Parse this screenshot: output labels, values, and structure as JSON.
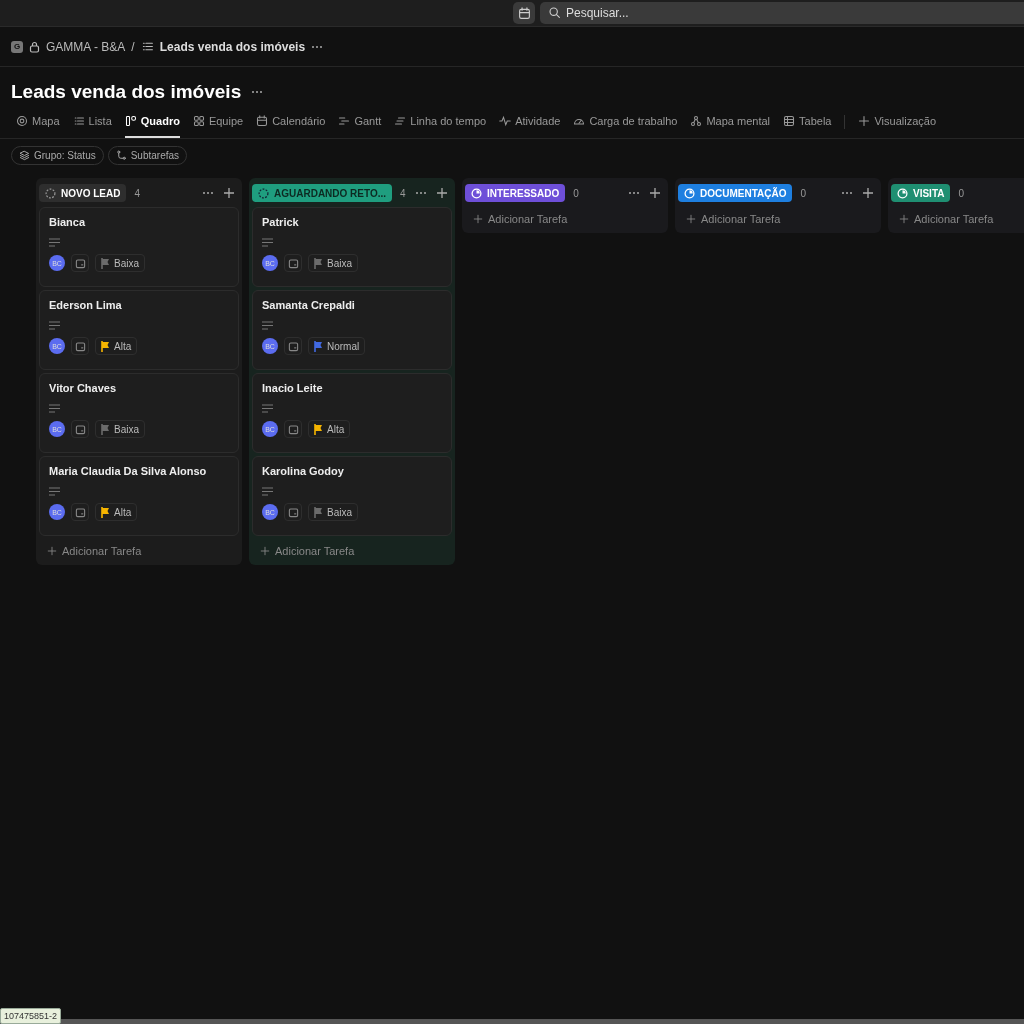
{
  "topbar": {
    "search": {
      "placeholder": "Pesquisar..."
    }
  },
  "breadcrumb": {
    "workspace_badge": "G",
    "workspace": "GAMMA - B&A",
    "separator": "/",
    "list": "Leads venda dos imóveis"
  },
  "title": "Leads venda dos imóveis",
  "tabs": [
    {
      "label": "Mapa",
      "selected": false
    },
    {
      "label": "Lista",
      "selected": false
    },
    {
      "label": "Quadro",
      "selected": true
    },
    {
      "label": "Equipe",
      "selected": false
    },
    {
      "label": "Calendário",
      "selected": false
    },
    {
      "label": "Gantt",
      "selected": false
    },
    {
      "label": "Linha do tempo",
      "selected": false
    },
    {
      "label": "Atividade",
      "selected": false
    },
    {
      "label": "Carga de trabalho",
      "selected": false
    },
    {
      "label": "Mapa mental",
      "selected": false
    },
    {
      "label": "Tabela",
      "selected": false
    }
  ],
  "add_view": "Visualização",
  "filters": [
    {
      "label": "Grupo: Status"
    },
    {
      "label": "Subtarefas"
    }
  ],
  "columns": [
    {
      "status": "NOVO LEAD",
      "kind": "dashed",
      "color": "#2e2e2e",
      "count": "4",
      "tasks": [
        {
          "name": "Bianca",
          "assignee": "BC",
          "priority": "Baixa",
          "color": "#6b6b6b"
        },
        {
          "name": "Ederson Lima",
          "assignee": "BC",
          "priority": "Alta",
          "color": "#f5b400"
        },
        {
          "name": "Vitor Chaves",
          "assignee": "BC",
          "priority": "Baixa",
          "color": "#6b6b6b"
        },
        {
          "name": "Maria Claudia Da Silva Alonso",
          "assignee": "BC",
          "priority": "Alta",
          "color": "#f5b400"
        }
      ],
      "add": "Adicionar Tarefa"
    },
    {
      "status": "AGUARDANDO RETO...",
      "kind": "dashed",
      "color": "#1f9e7f",
      "count": "4",
      "tasks": [
        {
          "name": "Patrick",
          "assignee": "BC",
          "priority": "Baixa",
          "color": "#6b6b6b"
        },
        {
          "name": "Samanta Crepaldi",
          "assignee": "BC",
          "priority": "Normal",
          "color": "#4169e1"
        },
        {
          "name": "Inacio Leite",
          "assignee": "BC",
          "priority": "Alta",
          "color": "#f5b400"
        },
        {
          "name": "Karolina Godoy",
          "assignee": "BC",
          "priority": "Baixa",
          "color": "#6b6b6b"
        }
      ],
      "add": "Adicionar Tarefa"
    },
    {
      "status": "INTERESSADO",
      "kind": "progress",
      "color": "#6e4fd8",
      "count": "0",
      "add": "Adicionar Tarefa"
    },
    {
      "status": "DOCUMENTAÇÃO",
      "kind": "progress",
      "color": "#1e7fe0",
      "count": "0",
      "add": "Adicionar Tarefa"
    },
    {
      "status": "VISITA",
      "kind": "progress",
      "color": "#1f8f72",
      "count": "0",
      "add": "Adicionar Tarefa"
    }
  ],
  "tooltip": "107475851-2"
}
